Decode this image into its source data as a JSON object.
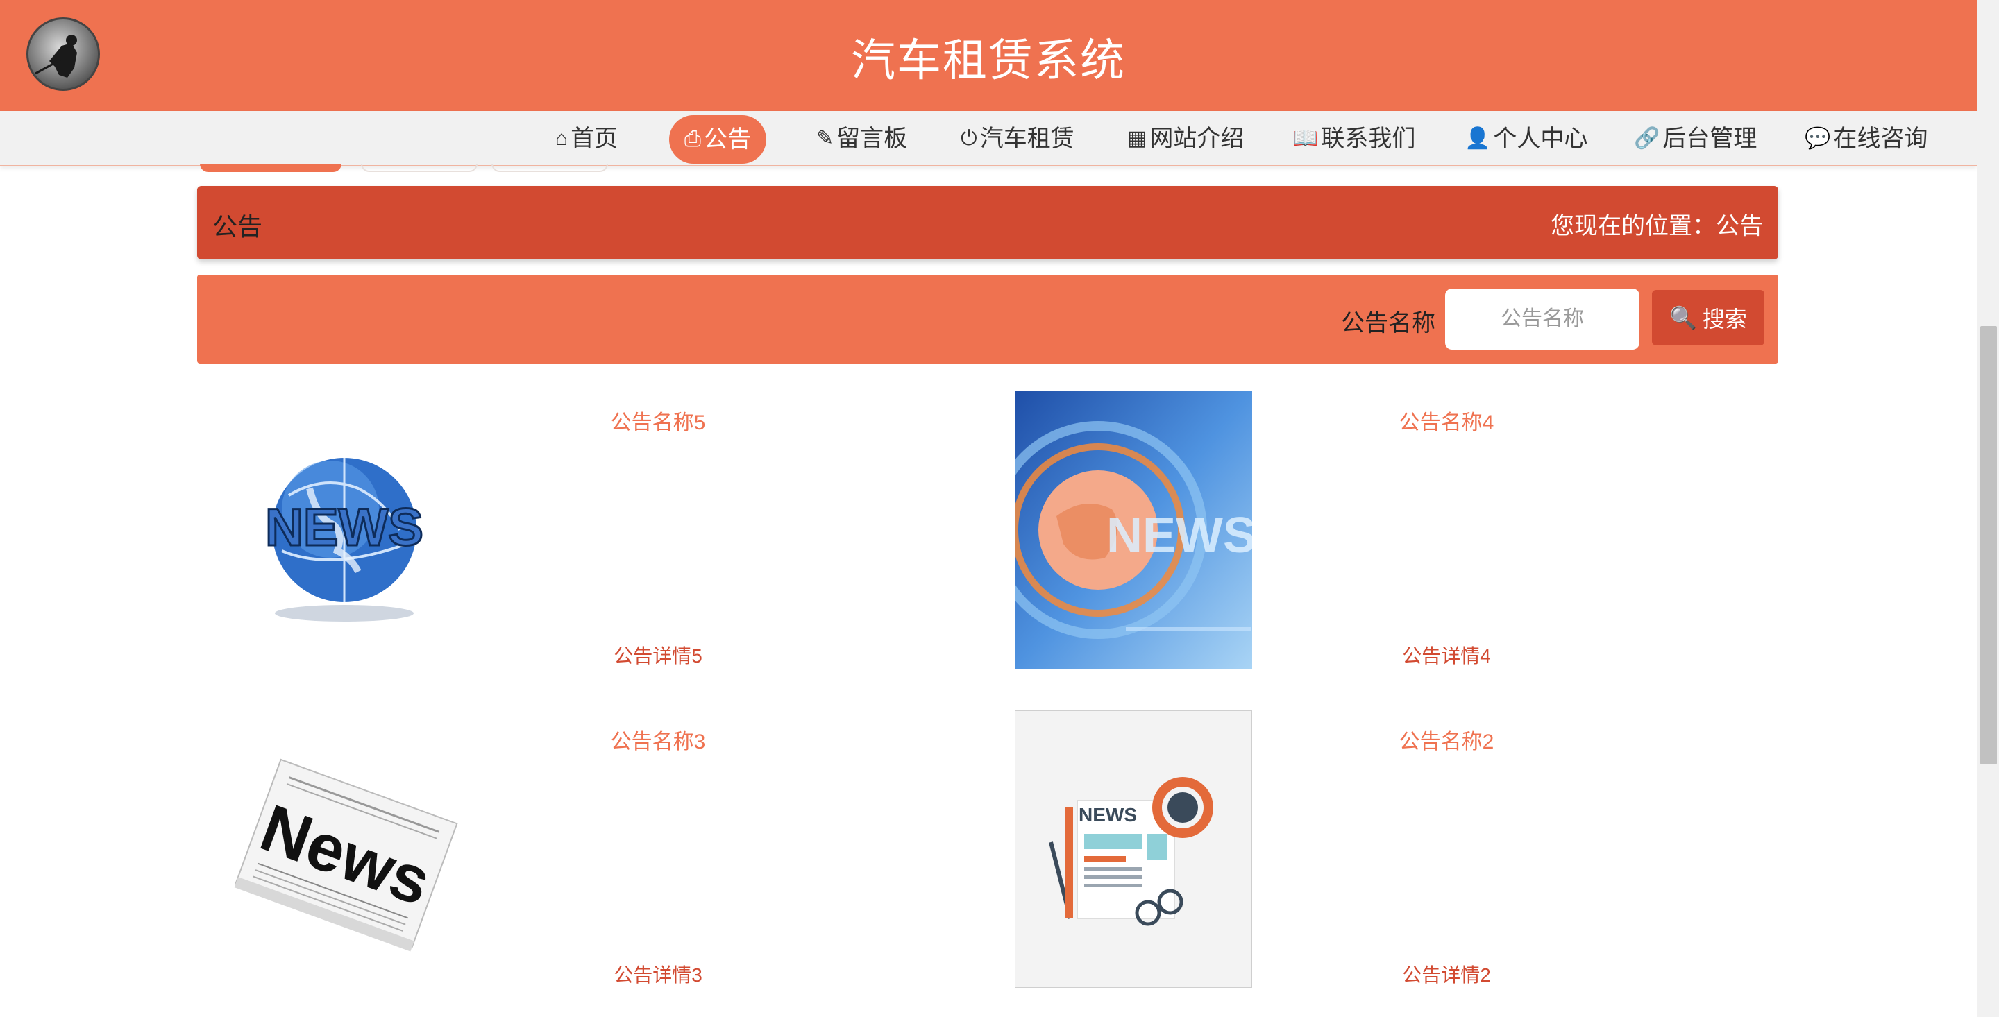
{
  "header": {
    "title": "汽车租赁系统"
  },
  "nav": {
    "items": [
      {
        "icon": "⌂",
        "label": "首页"
      },
      {
        "icon": "⎙",
        "label": "公告"
      },
      {
        "icon": "✎",
        "label": "留言板"
      },
      {
        "icon": "⏻",
        "label": "汽车租赁"
      },
      {
        "icon": "▦",
        "label": "网站介绍"
      },
      {
        "icon": "📖",
        "label": "联系我们"
      },
      {
        "icon": "👤",
        "label": "个人中心"
      },
      {
        "icon": "🔗",
        "label": "后台管理"
      },
      {
        "icon": "💬",
        "label": "在线咨询"
      }
    ],
    "active_index": 1
  },
  "breadcrumb": {
    "title": "公告",
    "location": "您现在的位置：公告"
  },
  "search": {
    "label": "公告名称",
    "placeholder": "公告名称",
    "value": "",
    "button_label": "搜索",
    "button_icon": "🔍"
  },
  "notices": [
    {
      "name": "公告名称5",
      "detail": "公告详情5",
      "image": "news-globe"
    },
    {
      "name": "公告名称4",
      "detail": "公告详情4",
      "image": "news-broadcast"
    },
    {
      "name": "公告名称3",
      "detail": "公告详情3",
      "image": "newspaper"
    },
    {
      "name": "公告名称2",
      "detail": "公告详情2",
      "image": "news-flat-illustration"
    }
  ],
  "colors": {
    "primary": "#ef7250",
    "dark": "#d24a31",
    "nav_bg": "#f1f1f1"
  }
}
